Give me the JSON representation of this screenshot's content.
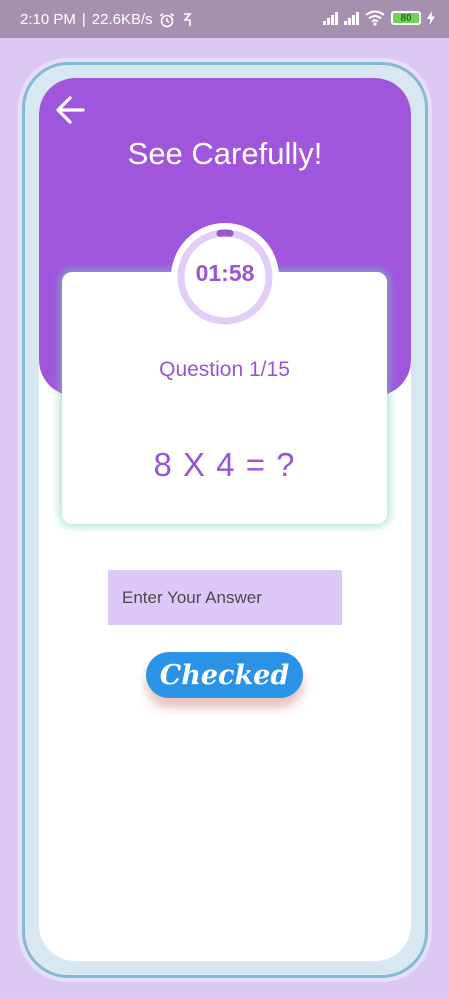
{
  "status_bar": {
    "time": "2:10 PM",
    "separator": "|",
    "speed": "22.6KB/s",
    "alarm_icon": "alarm-icon",
    "sync_icon": "sync-icon",
    "wifi_icon": "wifi-icon",
    "battery_level": "80",
    "charging_icon": "charging-icon"
  },
  "header": {
    "back_icon": "arrow-left-icon",
    "title": "See Carefully!"
  },
  "timer": {
    "time": "01:58"
  },
  "question": {
    "label": "Question 1/15",
    "expression": "8 X 4 = ?"
  },
  "answer": {
    "value": "",
    "placeholder": "Enter Your Answer"
  },
  "actions": {
    "check_label": "Checked"
  },
  "colors": {
    "header": "#a056dc",
    "accent_text": "#9a55d0",
    "input_bg": "#ddc9f9",
    "button": "#2b93e6",
    "page_bg": "#dcc9f3"
  }
}
